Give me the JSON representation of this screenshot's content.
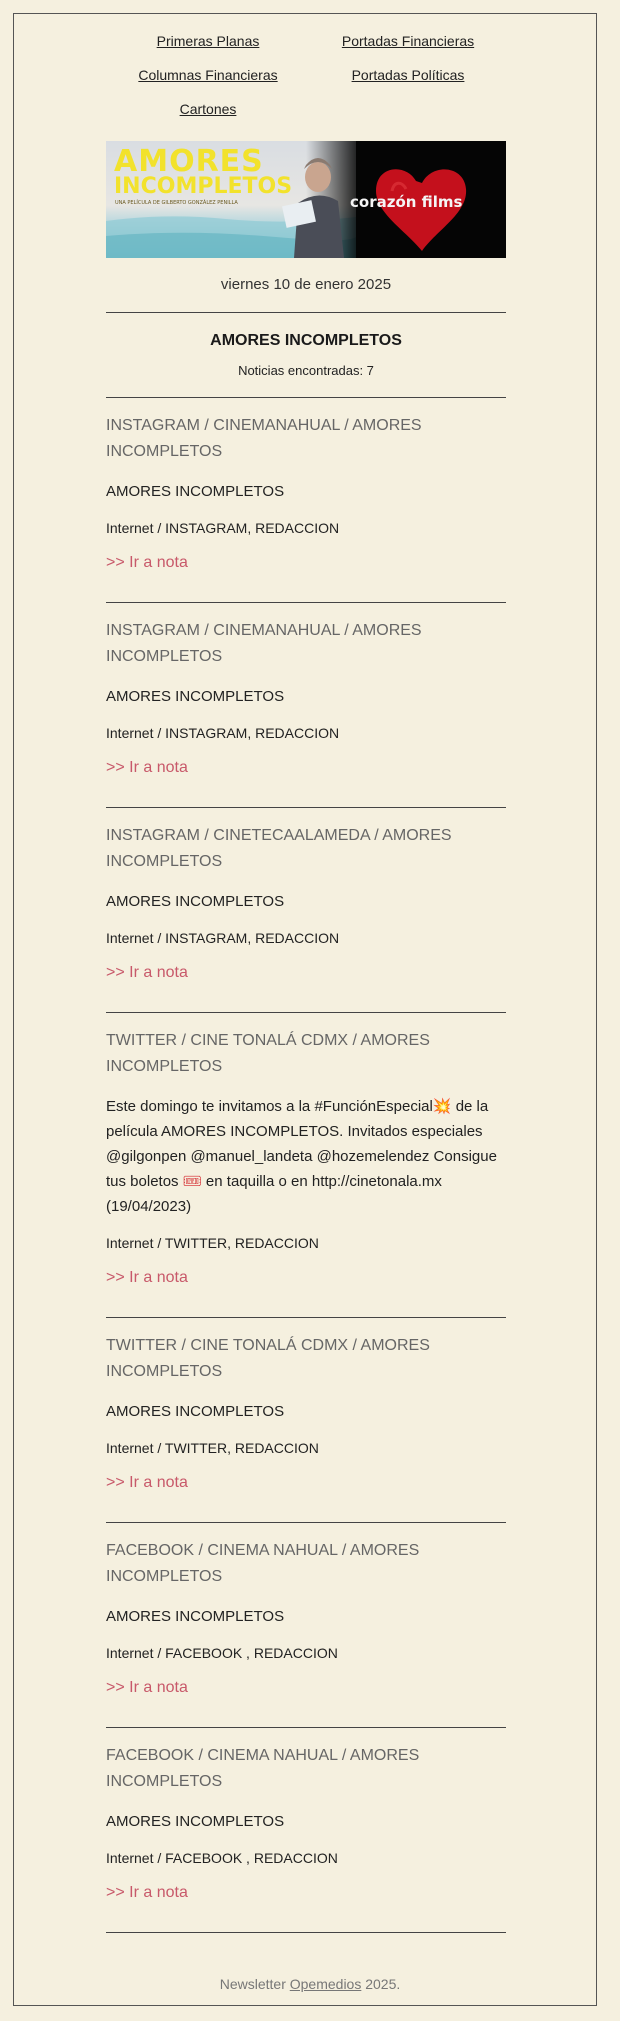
{
  "nav": {
    "links": [
      "Primeras Planas",
      "Portadas Financieras",
      "Columnas Financieras",
      "Portadas Políticas",
      "Cartones"
    ]
  },
  "banner": {
    "title_line1": "AMORES",
    "title_line2": "INCOMPLETOS",
    "tagline": "UNA PELÍCULA DE GILBERTO GONZÁLEZ PENILLA",
    "brand": "corazón films"
  },
  "date": "viernes 10 de enero 2025",
  "section": {
    "title": "AMORES INCOMPLETOS",
    "count": "Noticias encontradas: 7"
  },
  "items": [
    {
      "title": "INSTAGRAM / CINEMANAHUAL / AMORES INCOMPLETOS",
      "text": "AMORES INCOMPLETOS",
      "source": "Internet / INSTAGRAM, REDACCION",
      "link": ">> Ir a nota"
    },
    {
      "title": "INSTAGRAM / CINEMANAHUAL / AMORES INCOMPLETOS",
      "text": "AMORES INCOMPLETOS",
      "source": "Internet / INSTAGRAM, REDACCION",
      "link": ">> Ir a nota"
    },
    {
      "title": "INSTAGRAM / CINETECAALAMEDA / AMORES INCOMPLETOS",
      "text": "AMORES INCOMPLETOS",
      "source": "Internet / INSTAGRAM, REDACCION",
      "link": ">> Ir a nota"
    },
    {
      "title": "TWITTER / CINE TONALÁ CDMX / AMORES INCOMPLETOS",
      "text_part1": "Este domingo te invitamos a la #FunciónEspecial",
      "emoji1": "💥",
      "text_part2": " de la película AMORES INCOMPLETOS. Invitados especiales @gilgonpen @manuel_landeta @hozemelendez Consigue tus boletos ",
      "emoji2": "🎟",
      "text_part3": " en taquilla o en http://cinetonala.mx (19/04/2023)",
      "source": "Internet / TWITTER, REDACCION",
      "link": ">> Ir a nota"
    },
    {
      "title": "TWITTER / CINE TONALÁ CDMX / AMORES INCOMPLETOS",
      "text": "AMORES INCOMPLETOS",
      "source": "Internet / TWITTER, REDACCION",
      "link": ">> Ir a nota"
    },
    {
      "title": "FACEBOOK / CINEMA NAHUAL / AMORES INCOMPLETOS",
      "text": "AMORES INCOMPLETOS",
      "source": "Internet / FACEBOOK , REDACCION",
      "link": ">> Ir a nota"
    },
    {
      "title": "FACEBOOK / CINEMA NAHUAL / AMORES INCOMPLETOS",
      "text": "AMORES INCOMPLETOS",
      "source": "Internet / FACEBOOK , REDACCION",
      "link": ">> Ir a nota"
    }
  ],
  "footer": {
    "prefix": "Newsletter ",
    "link": "Opemedios",
    "suffix": " 2025."
  },
  "colors": {
    "background": "#f5f0df",
    "link_accent": "#c8596a",
    "title_gray": "#666666",
    "banner_yellow": "#f2e22c",
    "heart_red": "#c4101c"
  }
}
